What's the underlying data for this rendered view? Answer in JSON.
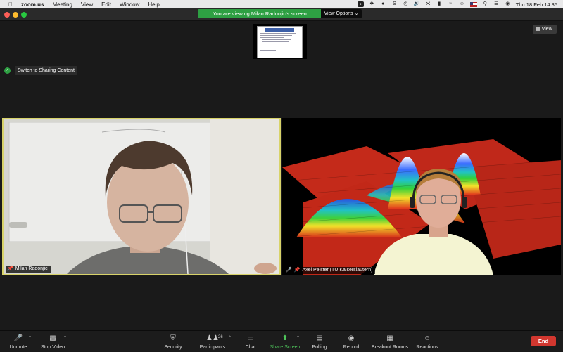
{
  "menubar": {
    "app": "zoom.us",
    "items": [
      "Meeting",
      "View",
      "Edit",
      "Window",
      "Help"
    ],
    "datetime": "Thu 18 Feb  14:35"
  },
  "share_banner": {
    "text": "You are viewing Milan Radonjic's screen",
    "view_options": "View Options"
  },
  "view_button": "View",
  "switch_button": "Switch to Sharing Content",
  "participants": [
    {
      "name": "Milan Radonjic"
    },
    {
      "name": "Axel Pelster (TU Kaiserslautern)"
    }
  ],
  "toolbar": {
    "unmute": "Unmute",
    "stop_video": "Stop Video",
    "security": "Security",
    "participants": "Participants",
    "participants_count": "26",
    "chat": "Chat",
    "share_screen": "Share Screen",
    "polling": "Polling",
    "record": "Record",
    "breakout_rooms": "Breakout Rooms",
    "reactions": "Reactions",
    "end": "End"
  },
  "colors": {
    "share_green": "#2ea043",
    "end_red": "#d1372f",
    "active_speaker": "#d8d36a"
  }
}
